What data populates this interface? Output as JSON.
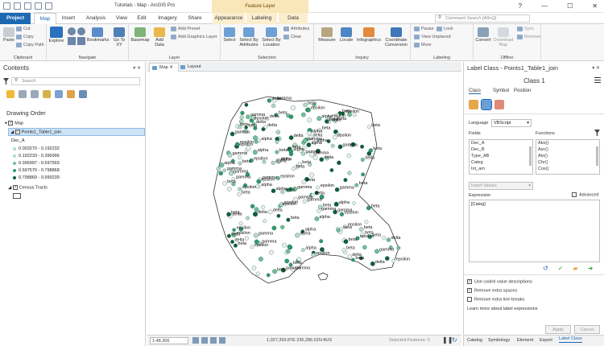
{
  "app": {
    "title": "Tutorials - Map - ArcGIS Pro",
    "context_title": "Feature Layer",
    "window_buttons": [
      "?",
      "—",
      "☐",
      "✕"
    ]
  },
  "tabs": {
    "project": "Project",
    "items": [
      "Map",
      "Insert",
      "Analysis",
      "View",
      "Edit",
      "Imagery",
      "Share"
    ],
    "context": [
      "Appearance",
      "Labeling",
      "Data"
    ],
    "command_search_placeholder": "Command Search (Alt+Q)"
  },
  "ribbon": {
    "clipboard": {
      "label": "Clipboard",
      "paste": "Paste",
      "cut": "Cut",
      "copy": "Copy",
      "copy_path": "Copy Path"
    },
    "navigate": {
      "label": "Navigate",
      "explore": "Explore",
      "bookmarks": "Bookmarks",
      "go_to_xy": "Go To XY"
    },
    "layer": {
      "label": "Layer",
      "basemap": "Basemap",
      "add_data": "Add Data",
      "add_preset": "Add Preset",
      "add_graphics_layer": "Add Graphics Layer"
    },
    "selection": {
      "label": "Selection",
      "select": "Select",
      "select_by_attributes": "Select By Attributes",
      "select_by_location": "Select By Location",
      "attributes": "Attributes",
      "clear": "Clear"
    },
    "inquiry": {
      "label": "Inquiry",
      "measure": "Measure",
      "locate": "Locate",
      "infographics": "Infographics",
      "coordinate_conversion": "Coordinate Conversion"
    },
    "labeling": {
      "label": "Labeling",
      "pause": "Pause",
      "lock": "Lock",
      "view_unplaced": "View Unplaced",
      "more": "More"
    },
    "offline": {
      "label": "Offline",
      "convert": "Convert",
      "download_map": "Download Map",
      "sync": "Sync",
      "remove": "Remove"
    }
  },
  "contents": {
    "title": "Contents",
    "search_placeholder": "Search",
    "drawing_order": "Drawing Order",
    "map_name": "Map",
    "layer1": "Points1_Table1_join",
    "field": "Dec_A",
    "classes": [
      {
        "label": "0.003270 - 0.192232",
        "color": "#e8f2ee"
      },
      {
        "label": "0.192233 - 0.396996",
        "color": "#b4d9c8"
      },
      {
        "label": "0.396997 - 0.597569",
        "color": "#6fbf9a"
      },
      {
        "label": "0.597570 - 0.798868",
        "color": "#2f9a6b"
      },
      {
        "label": "0.798869 - 0.999239",
        "color": "#0f5e3b"
      }
    ],
    "layer2": "Census Tracts"
  },
  "view": {
    "tabs": [
      "Map",
      "Layout"
    ],
    "scale": "1:48,306",
    "coordinates": "1,027,393.87E 236,286.01N ftUS",
    "selected_features": "Selected Features: 0",
    "labels": [
      "beta",
      "delta",
      "gamma",
      "alpha",
      "epsilon"
    ]
  },
  "label_class": {
    "title": "Label Class - Points1_Table1_join",
    "class_name": "Class 1",
    "tabs": [
      "Class",
      "Symbol",
      "Position"
    ],
    "language_label": "Language",
    "language_value": "VBScript",
    "fields_label": "Fields",
    "functions_label": "Functions",
    "fields": [
      "Dec_A",
      "Dec_B",
      "Type_AB",
      "Categ",
      "Int_am"
    ],
    "functions": [
      "Abs()",
      "Asc()",
      "Atn()",
      "Chr()",
      "Cos()"
    ],
    "insert_values": "Insert Values",
    "expression_label": "Expression",
    "advanced_label": "Advanced",
    "expression": "[Categ]",
    "options": [
      {
        "label": "Use coded value descriptions",
        "checked": true
      },
      {
        "label": "Remove extra spaces",
        "checked": true
      },
      {
        "label": "Remove extra line breaks",
        "checked": false
      }
    ],
    "learn_more": "Learn more about label expressions",
    "apply": "Apply",
    "cancel": "Cancel",
    "bottom_tabs": [
      "Catalog",
      "Symbology",
      "Element",
      "Export",
      "Label Class"
    ]
  }
}
